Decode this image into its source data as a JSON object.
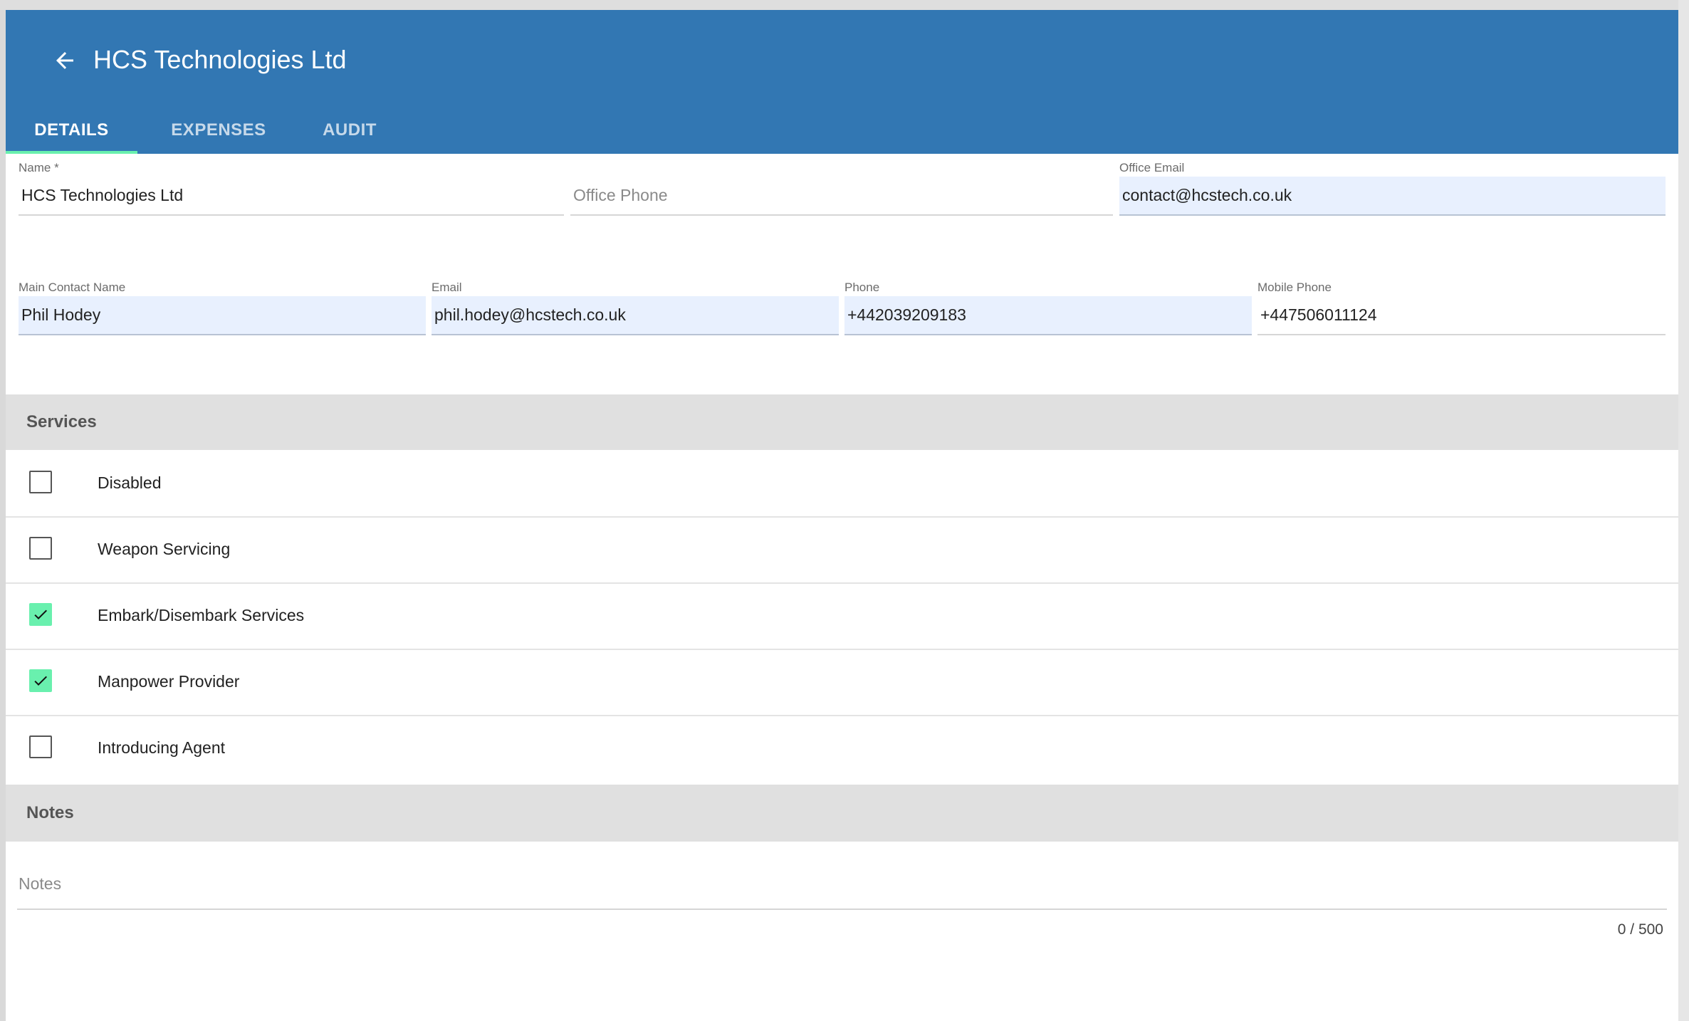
{
  "header": {
    "title": "HCS Technologies Ltd",
    "tabs": [
      {
        "label": "DETAILS",
        "active": true
      },
      {
        "label": "EXPENSES",
        "active": false
      },
      {
        "label": "AUDIT",
        "active": false
      }
    ]
  },
  "company": {
    "name_label": "Name *",
    "name_value": "HCS Technologies Ltd",
    "office_phone_placeholder": "Office Phone",
    "office_email_label": "Office Email",
    "office_email_value": "contact@hcstech.co.uk"
  },
  "contact": {
    "main_contact_label": "Main Contact Name",
    "main_contact_value": "Phil Hodey",
    "email_label": "Email",
    "email_value": "phil.hodey@hcstech.co.uk",
    "phone_label": "Phone",
    "phone_value": "+442039209183",
    "mobile_label": "Mobile Phone",
    "mobile_value": "+447506011124"
  },
  "services": {
    "header": "Services",
    "items": [
      {
        "label": "Disabled",
        "checked": false
      },
      {
        "label": "Weapon Servicing",
        "checked": false
      },
      {
        "label": "Embark/Disembark Services",
        "checked": true
      },
      {
        "label": "Manpower Provider",
        "checked": true
      },
      {
        "label": "Introducing Agent",
        "checked": false
      }
    ]
  },
  "notes": {
    "header": "Notes",
    "placeholder": "Notes",
    "counter": "0 / 500"
  },
  "colors": {
    "appbar": "#3277b3",
    "accent": "#69f0ae",
    "autofill": "#e8f0fe"
  }
}
